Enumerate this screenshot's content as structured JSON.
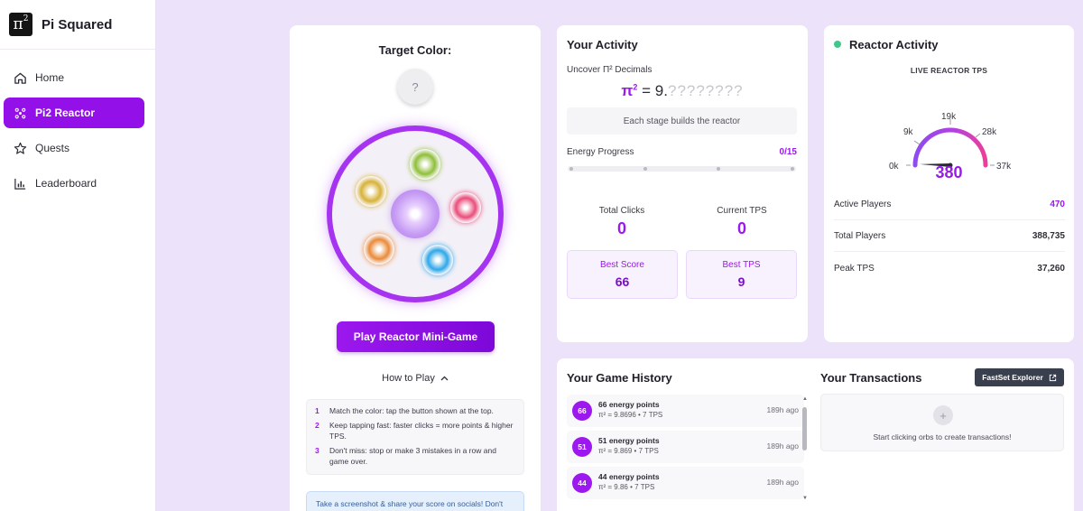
{
  "app": {
    "logo_symbol": "π",
    "logo_sup": "2",
    "title": "Pi Squared"
  },
  "sidebar": {
    "items": [
      {
        "label": "Home",
        "icon": "home-icon",
        "active": false
      },
      {
        "label": "Pi2 Reactor",
        "icon": "atom-icon",
        "active": true
      },
      {
        "label": "Quests",
        "icon": "star-icon",
        "active": false
      },
      {
        "label": "Leaderboard",
        "icon": "bar-chart-icon",
        "active": false
      }
    ]
  },
  "target": {
    "title": "Target Color:",
    "value": "?",
    "play_label": "Play Reactor Mini-Game",
    "how_to_label": "How to Play",
    "rules": [
      {
        "num": "1",
        "text": "Match the color: tap the button shown at the top."
      },
      {
        "num": "2",
        "text": "Keep tapping fast: faster clicks = more points & higher TPS."
      },
      {
        "num": "3",
        "text": "Don't miss: stop or make 3 mistakes in a row and game over."
      }
    ],
    "share_text": "Take a screenshot & share your score on socials! Don't",
    "orb_colors": [
      "#8fbf3a",
      "#e94d7b",
      "#2fa7e8",
      "#e98a3a",
      "#d7b23a"
    ]
  },
  "activity": {
    "title": "Your Activity",
    "uncover_label": "Uncover Π² Decimals",
    "pi_symbol": "π",
    "pi_sup": "2",
    "pi_eq": "= 9",
    "pi_dot": ".",
    "pi_hidden": "????????",
    "stage_text": "Each stage builds the reactor",
    "energy_label": "Energy Progress",
    "energy_value": "0/15",
    "energy_progress": 0,
    "total_clicks_label": "Total Clicks",
    "total_clicks": "0",
    "current_tps_label": "Current TPS",
    "current_tps": "0",
    "best_score_label": "Best Score",
    "best_score": "66",
    "best_tps_label": "Best TPS",
    "best_tps": "9"
  },
  "reactor": {
    "title": "Reactor Activity",
    "live_label": "LIVE REACTOR TPS",
    "gauge_ticks": [
      "0k",
      "9k",
      "19k",
      "28k",
      "37k"
    ],
    "gauge_max": 37000,
    "tps": "380",
    "rows": [
      {
        "label": "Active Players",
        "value": "470",
        "accent": true
      },
      {
        "label": "Total Players",
        "value": "388,735",
        "accent": false
      },
      {
        "label": "Peak TPS",
        "value": "37,260",
        "accent": false
      }
    ]
  },
  "history": {
    "title": "Your Game History",
    "items": [
      {
        "badge": "66",
        "main": "66 energy points",
        "sub": "π² = 9.8696 • 7 TPS",
        "time": "189h ago"
      },
      {
        "badge": "51",
        "main": "51 energy points",
        "sub": "π² = 9.869 • 7 TPS",
        "time": "189h ago"
      },
      {
        "badge": "44",
        "main": "44 energy points",
        "sub": "π² = 9.86 • 7 TPS",
        "time": "189h ago"
      }
    ]
  },
  "transactions": {
    "title": "Your Transactions",
    "explorer_label": "FastSet Explorer",
    "empty_text": "Start clicking orbs to create transactions!"
  },
  "colors": {
    "accent": "#9c18ee",
    "background": "#ece3fb",
    "live": "#3ec98a"
  }
}
